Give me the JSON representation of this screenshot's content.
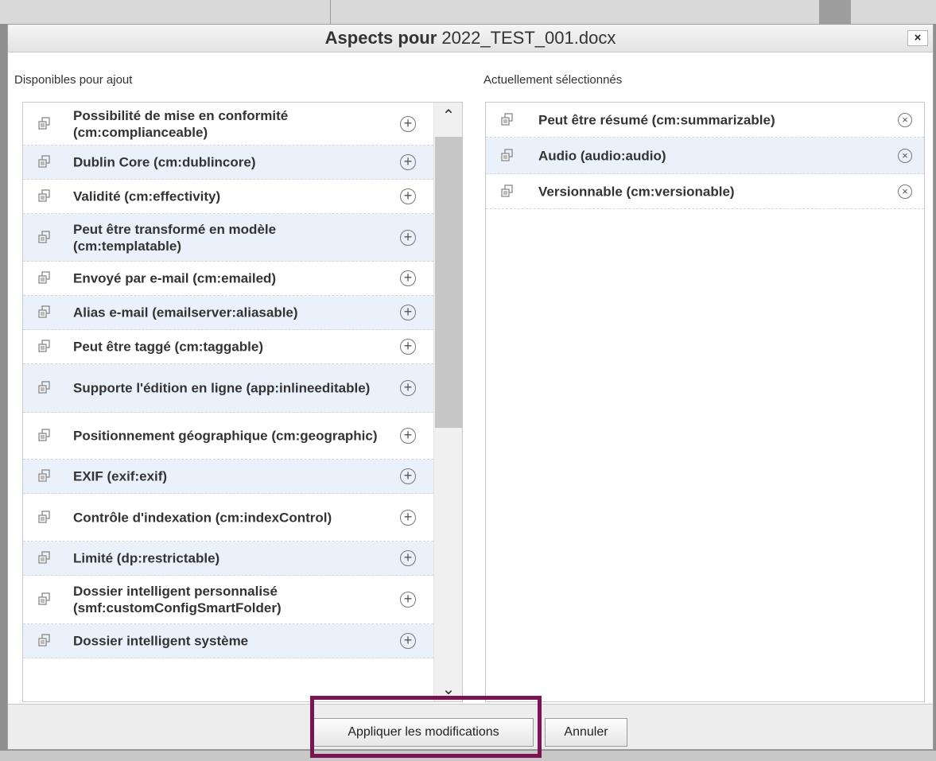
{
  "dialog": {
    "title_prefix": "Aspects pour",
    "title_file": "2022_TEST_001.docx",
    "close_label": "×"
  },
  "available": {
    "label": "Disponibles pour ajout",
    "items": [
      {
        "label": "Possibilité de mise en conformité (cm:complianceable)"
      },
      {
        "label": "Dublin Core (cm:dublincore)"
      },
      {
        "label": "Validité (cm:effectivity)"
      },
      {
        "label": "Peut être transformé en modèle (cm:templatable)"
      },
      {
        "label": "Envoyé par e-mail (cm:emailed)"
      },
      {
        "label": "Alias e-mail (emailserver:aliasable)"
      },
      {
        "label": "Peut être taggé (cm:taggable)"
      },
      {
        "label": "Supporte l'édition en ligne (app:inlineeditable)"
      },
      {
        "label": "Positionnement géographique (cm:geographic)"
      },
      {
        "label": "EXIF (exif:exif)"
      },
      {
        "label": "Contrôle d'indexation (cm:indexControl)"
      },
      {
        "label": "Limité (dp:restrictable)"
      },
      {
        "label": "Dossier intelligent personnalisé (smf:customConfigSmartFolder)"
      },
      {
        "label": "Dossier intelligent système"
      }
    ],
    "add_symbol": "+"
  },
  "selected": {
    "label": "Actuellement sélectionnés",
    "items": [
      {
        "label": "Peut être résumé (cm:summarizable)"
      },
      {
        "label": "Audio (audio:audio)"
      },
      {
        "label": "Versionnable (cm:versionable)"
      }
    ],
    "remove_symbol": "×"
  },
  "footer": {
    "apply_label": "Appliquer les modifications",
    "cancel_label": "Annuler"
  },
  "colors": {
    "row_alt": "#eaf1fb",
    "highlight": "#7b1450"
  },
  "icons": {
    "aspect": "aspect-icon",
    "add": "add-circle-icon",
    "remove": "remove-circle-icon",
    "close": "close-icon",
    "scroll_up": "chevron-up-icon",
    "scroll_down": "chevron-down-icon"
  }
}
